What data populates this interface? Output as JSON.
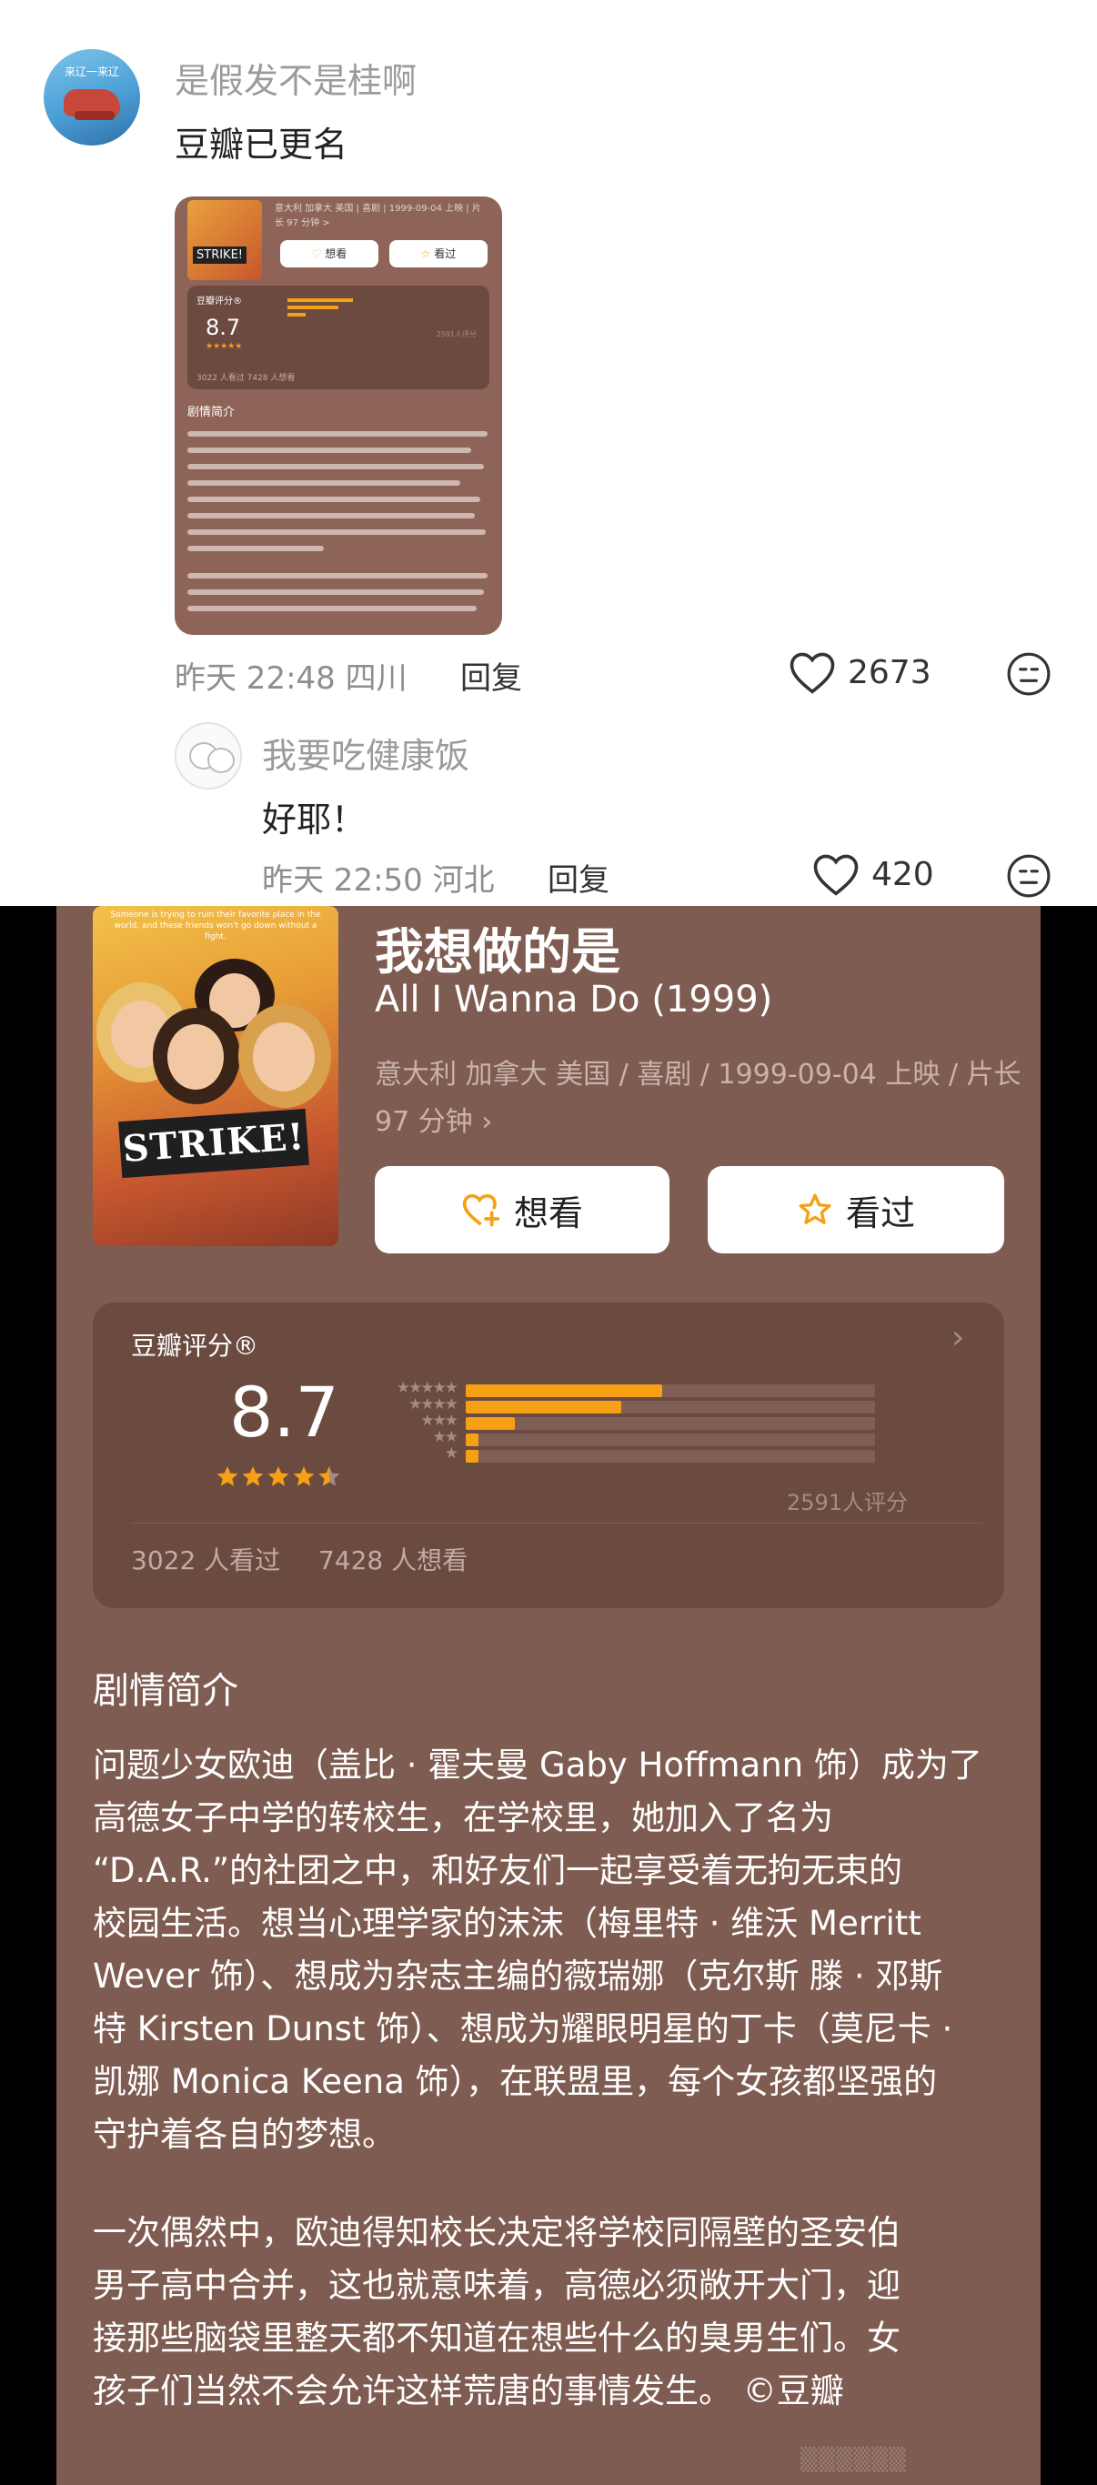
{
  "comments": [
    {
      "username": "是假发不是桂啊",
      "avatar_text": "来辽一来辽",
      "text": "豆瓣已更名",
      "time": "昨天 22:48",
      "location": "四川",
      "reply_label": "回复",
      "likes": "2673"
    },
    {
      "username": "我要吃健康饭",
      "text": "好耶！",
      "time": "昨天 22:50",
      "location": "河北",
      "reply_label": "回复",
      "likes": "420"
    }
  ],
  "movie": {
    "title_zh": "我想做的是",
    "title_en": "All I Wanna Do (1999)",
    "meta_line1": "意大利 加拿大 美国 / 喜剧 / 1999-09-04 上映 / 片长",
    "meta_line2": "97 分钟",
    "poster_strike": "STRIKE!",
    "poster_tagline": "Someone is trying to ruin their favorite place in the world, and these friends won't go down without a fight.",
    "want_label": "想看",
    "watched_label": "看过"
  },
  "rating": {
    "label": "豆瓣评分®",
    "score": "8.7",
    "stars": 4.5,
    "distribution": [
      {
        "stars": "★★★★★",
        "fraction": 0.48
      },
      {
        "stars": "★★★★",
        "fraction": 0.38
      },
      {
        "stars": "★★★",
        "fraction": 0.12
      },
      {
        "stars": "★★",
        "fraction": 0.03
      },
      {
        "stars": "★",
        "fraction": 0.03
      }
    ],
    "count": "2591人评分",
    "watched": "3022 人看过",
    "wanted": "7428 人想看"
  },
  "synopsis": {
    "heading": "剧情简介",
    "lines1": [
      "问题少女欧迪（盖比 · 霍夫曼 Gaby Hoffmann 饰）成为了",
      "高德女子中学的转校生，在学校里，她加入了名为",
      "“D.A.R.”的社团之中，和好友们一起享受着无拘无束的",
      "校园生活。想当心理学家的沫沫（梅里特 · 维沃 Merritt",
      "Wever 饰）、想成为杂志主编的薇瑞娜（克尔斯 滕 · 邓斯",
      "特 Kirsten Dunst 饰）、想成为耀眼明星的丁卡（莫尼卡 ·",
      "凯娜 Monica Keena 饰），在联盟里，每个女孩都坚强的",
      "守护着各自的梦想。"
    ],
    "lines2": [
      "一次偶然中，欧迪得知校长决定将学校同隔壁的圣安伯",
      "男子高中合并，这也就意味着，高德必须敞开大门，迎",
      "接那些脑袋里整天都不知道在想些什么的臭男生们。女",
      "孩子们当然不会允许这样荒唐的事情发生。 ©豆瓣"
    ]
  },
  "thumbnail": {
    "meta": "意大利 加拿大 美国 | 喜剧 | 1999-09-04 上映 | 片长 97 分钟 >",
    "want_label": "想看",
    "watched_label": "看过",
    "rating_label": "豆瓣评分®",
    "score": "8.7",
    "count": "2591人评分",
    "stats": "3022 人看过  7428 人想看",
    "heading": "剧情简介"
  },
  "colors": {
    "brown_bg": "#7f5c51",
    "card_bg": "#6b4a40",
    "accent_orange": "#f5a015"
  }
}
